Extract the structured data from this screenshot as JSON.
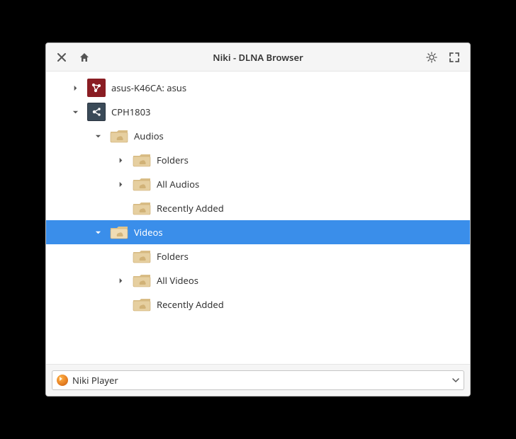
{
  "window": {
    "title": "Niki - DLNA Browser"
  },
  "tree": [
    {
      "indent": 0,
      "expander": "right",
      "iconType": "device1",
      "label": "asus-K46CA: asus",
      "selected": false
    },
    {
      "indent": 0,
      "expander": "down",
      "iconType": "device2",
      "label": "CPH1803",
      "selected": false
    },
    {
      "indent": 1,
      "expander": "down",
      "iconType": "folder",
      "label": "Audios",
      "selected": false
    },
    {
      "indent": 2,
      "expander": "right",
      "iconType": "folder",
      "label": "Folders",
      "selected": false
    },
    {
      "indent": 2,
      "expander": "right",
      "iconType": "folder",
      "label": "All Audios",
      "selected": false
    },
    {
      "indent": 2,
      "expander": "none",
      "iconType": "folder",
      "label": "Recently Added",
      "selected": false
    },
    {
      "indent": 1,
      "expander": "down",
      "iconType": "folder",
      "label": "Videos",
      "selected": true
    },
    {
      "indent": 2,
      "expander": "none",
      "iconType": "folder",
      "label": "Folders",
      "selected": false
    },
    {
      "indent": 2,
      "expander": "right",
      "iconType": "folder",
      "label": "All Videos",
      "selected": false
    },
    {
      "indent": 2,
      "expander": "none",
      "iconType": "folder",
      "label": "Recently Added",
      "selected": false
    }
  ],
  "combo": {
    "label": "Niki Player"
  },
  "indentBase": 24,
  "indentStep": 32
}
